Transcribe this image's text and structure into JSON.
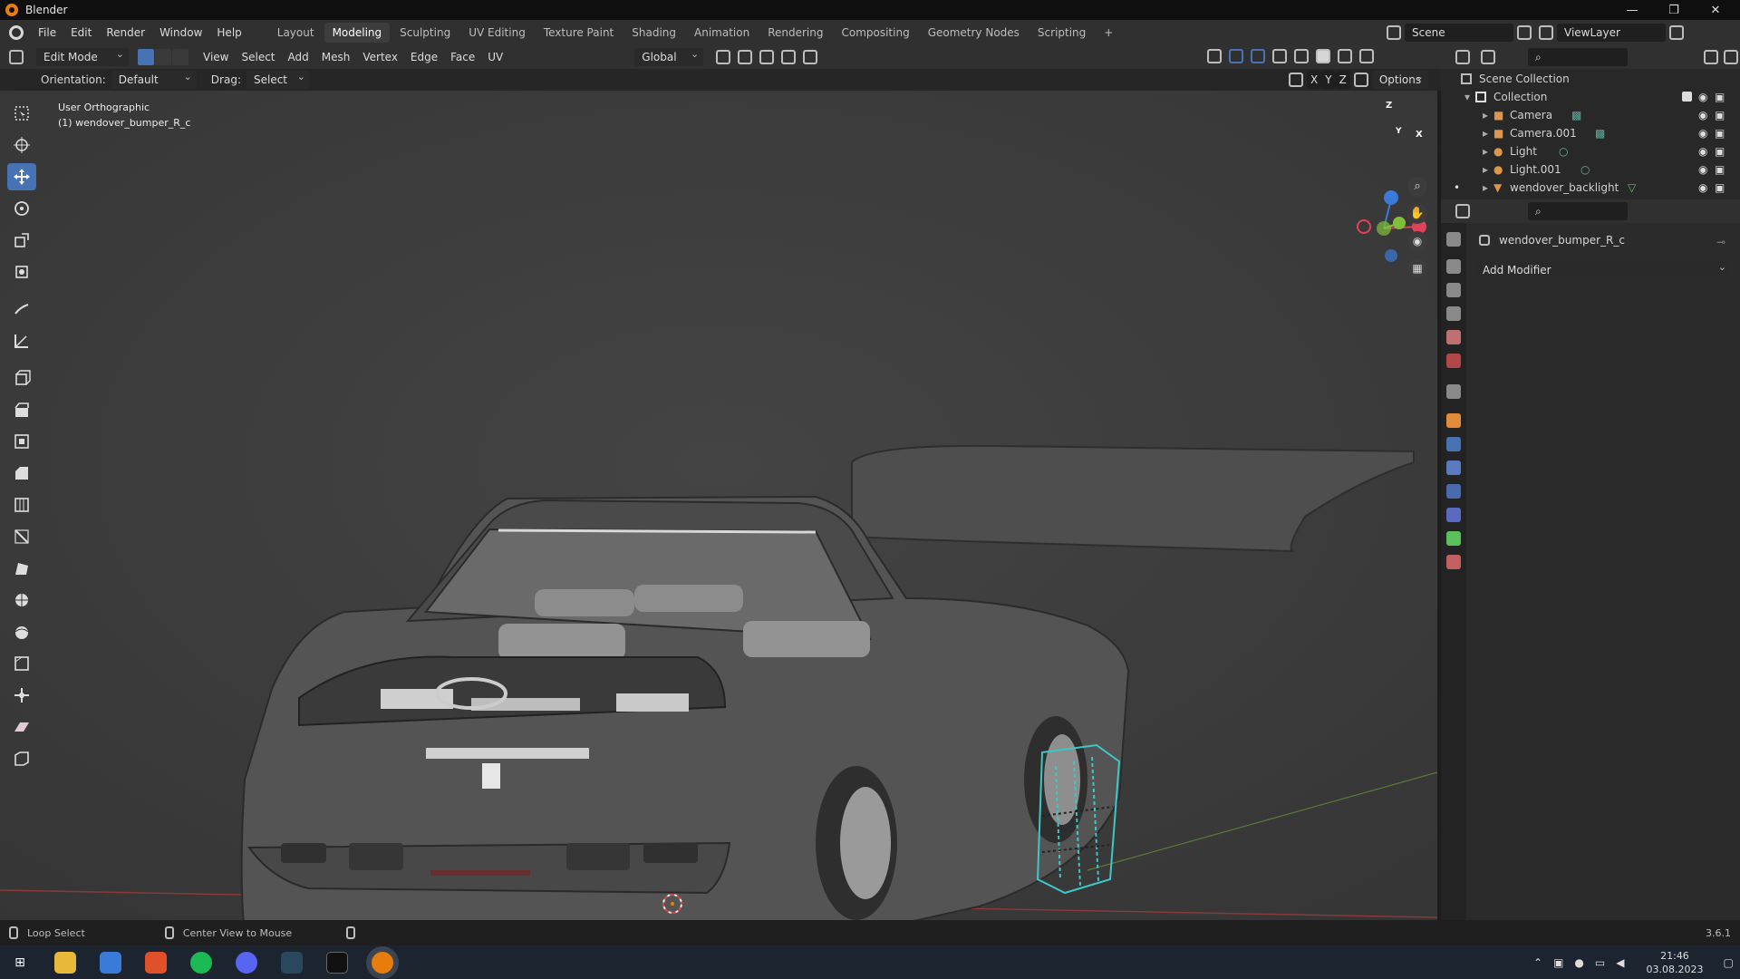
{
  "window": {
    "title": "Blender"
  },
  "menus": [
    "File",
    "Edit",
    "Render",
    "Window",
    "Help"
  ],
  "workspace_tabs": [
    "Layout",
    "Modeling",
    "Sculpting",
    "UV Editing",
    "Texture Paint",
    "Shading",
    "Animation",
    "Rendering",
    "Compositing",
    "Geometry Nodes",
    "Scripting"
  ],
  "active_workspace": "Modeling",
  "scene": {
    "name": "Scene",
    "view_layer": "ViewLayer"
  },
  "viewport_header": {
    "mode": "Edit Mode",
    "menus": [
      "View",
      "Select",
      "Add",
      "Mesh",
      "Vertex",
      "Edge",
      "Face",
      "UV"
    ],
    "transform_orientation": "Global"
  },
  "tool_settings": {
    "orientation_label": "Orientation:",
    "orientation_value": "Default",
    "drag_label": "Drag:",
    "drag_value": "Select Box",
    "axis": [
      "X",
      "Y",
      "Z"
    ],
    "options": "Options"
  },
  "viewport": {
    "view_name": "User Orthographic",
    "object_label": "(1) wendover_bumper_R_c",
    "gizmo": {
      "x": "X",
      "y": "Y",
      "z": "Z"
    }
  },
  "outliner": {
    "root": "Scene Collection",
    "collection": "Collection",
    "items": [
      {
        "name": "Camera",
        "type": "camera"
      },
      {
        "name": "Camera.001",
        "type": "camera"
      },
      {
        "name": "Light",
        "type": "light"
      },
      {
        "name": "Light.001",
        "type": "light"
      },
      {
        "name": "wendover_backlight",
        "type": "mesh"
      }
    ]
  },
  "properties": {
    "object_name": "wendover_bumper_R_c",
    "add_modifier": "Add Modifier"
  },
  "statusbar": {
    "left": "Loop Select",
    "middle": "Center View to Mouse",
    "version": "3.6.1"
  },
  "taskbar": {
    "time": "21:46",
    "date": "03.08.2023"
  },
  "colors": {
    "accent": "#4772b3",
    "selection": "#3ec7c9",
    "origin": "#e87d0d",
    "axis_x": "#e0425a",
    "axis_y": "#7ec03a",
    "axis_z": "#3b7ad9"
  }
}
